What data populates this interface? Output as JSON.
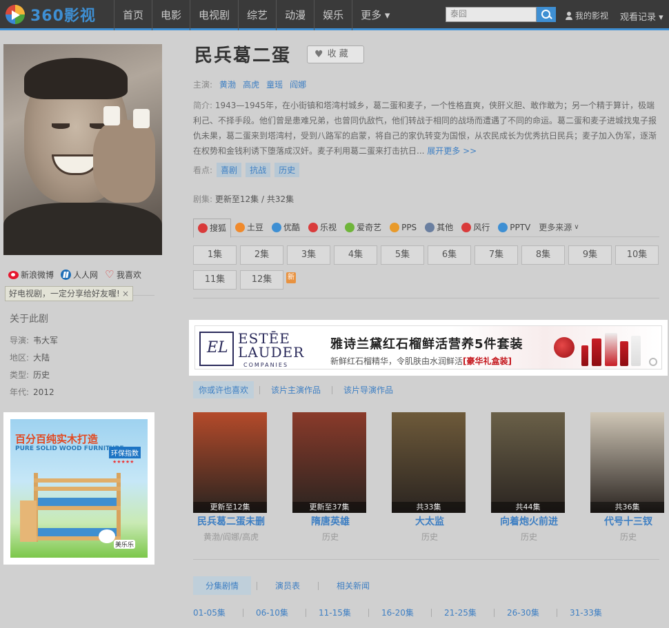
{
  "brand": {
    "logo_text": "360影视"
  },
  "nav": {
    "items": [
      "首页",
      "电影",
      "电视剧",
      "综艺",
      "动漫",
      "娱乐",
      "更多 ▾"
    ],
    "search_placeholder": "泰囧",
    "my_videos": "我的影视",
    "history": "观看记录 ▾"
  },
  "left": {
    "share": {
      "weibo": "新浪微博",
      "renren": "人人网",
      "like": "我喜欢"
    },
    "tip": "好电视剧，一定分享给好友喔!",
    "tip_close": "×",
    "about_title": "关于此剧",
    "about_rows": [
      {
        "label": "导演:",
        "value": "韦大军"
      },
      {
        "label": "地区:",
        "value": "大陆"
      },
      {
        "label": "类型:",
        "value": "历史"
      },
      {
        "label": "年代:",
        "value": "2012"
      }
    ],
    "ad": {
      "title": "百分百纯实木打造",
      "sub": "PURE SOLID WOOD FURNITURE",
      "badge": "环保指数",
      "stars": "★★★★★",
      "brand": "美乐乐"
    }
  },
  "show": {
    "title": "民兵葛二蛋",
    "fav_label": "收 藏",
    "cast_label": "主演:",
    "cast": [
      "黄渤",
      "高虎",
      "童瑶",
      "阎娜"
    ],
    "synopsis_label": "简介:",
    "synopsis": "1943—1945年，在小街镇和塔湾村城乡，葛二蛋和麦子，一个性格直爽，侠肝义胆、敢作敢为；另一个精于算计，极端利己、不择手段。他们曾是患难兄弟，也曾同仇敌忾，他们转战于相同的战场而遭遇了不同的命运。葛二蛋和麦子进城找鬼子报仇未果，葛二蛋来到塔湾村，受到八路军的启蒙，将自己的家仇转变为国恨，从农民成长为优秀抗日民兵；麦子加入伪军，逐渐在权势和金钱利诱下堕落成汉奸。麦子利用葛二蛋来打击抗日...",
    "synopsis_more": "展开更多 >>",
    "tags_label": "看点:",
    "tags": [
      "喜剧",
      "抗战",
      "历史"
    ],
    "episodes_label": "剧集:",
    "episodes_info": "更新至12集 / 共32集"
  },
  "sources": [
    {
      "name": "搜狐",
      "color": "#d93b3b"
    },
    {
      "name": "土豆",
      "color": "#f08a2c"
    },
    {
      "name": "优酷",
      "color": "#3e8fd3"
    },
    {
      "name": "乐视",
      "color": "#d93b3b"
    },
    {
      "name": "爱奇艺",
      "color": "#6fb53a"
    },
    {
      "name": "PPS",
      "color": "#e89a2a"
    },
    {
      "name": "其他",
      "color": "#6a7fa0"
    },
    {
      "name": "风行",
      "color": "#d93b3b"
    },
    {
      "name": "PPTV",
      "color": "#3e8fd3"
    }
  ],
  "sources_more": "更多来源",
  "episodes": [
    "1集",
    "2集",
    "3集",
    "4集",
    "5集",
    "6集",
    "7集",
    "8集",
    "9集",
    "10集",
    "11集",
    "12集"
  ],
  "new_badge": "新",
  "banner": {
    "brand_line1": "ESTĒE",
    "brand_line2": "LAUDER",
    "brand_line3": "COMPANIES",
    "headline": "雅诗兰黛红石榴鲜活营养5件套装",
    "sub": "新鲜红石榴精华，令肌肤由水润鲜活",
    "sub_tag": "[豪华礼盒装]"
  },
  "rec_tabs": [
    "你或许也喜欢",
    "该片主演作品",
    "该片导演作品"
  ],
  "recommendations": [
    {
      "title": "民兵葛二蛋未删",
      "caption": "更新至12集",
      "sub": "黄渤/阎娜/高虎",
      "bg": "#b44a2a"
    },
    {
      "title": "隋唐英雄",
      "caption": "更新至37集",
      "sub": "历史",
      "bg": "#8a3a2a"
    },
    {
      "title": "大太监",
      "caption": "共33集",
      "sub": "历史",
      "bg": "#6e5a3a"
    },
    {
      "title": "向着炮火前进",
      "caption": "共44集",
      "sub": "历史",
      "bg": "#6a6048"
    },
    {
      "title": "代号十三钗",
      "caption": "共36集",
      "sub": "历史",
      "bg": "#cfc6b6"
    }
  ],
  "bottom_tabs": [
    "分集剧情",
    "演员表",
    "相关新闻"
  ],
  "ranges": [
    "01-05集",
    "06-10集",
    "11-15集",
    "16-20集",
    "21-25集",
    "26-30集",
    "31-33集"
  ]
}
